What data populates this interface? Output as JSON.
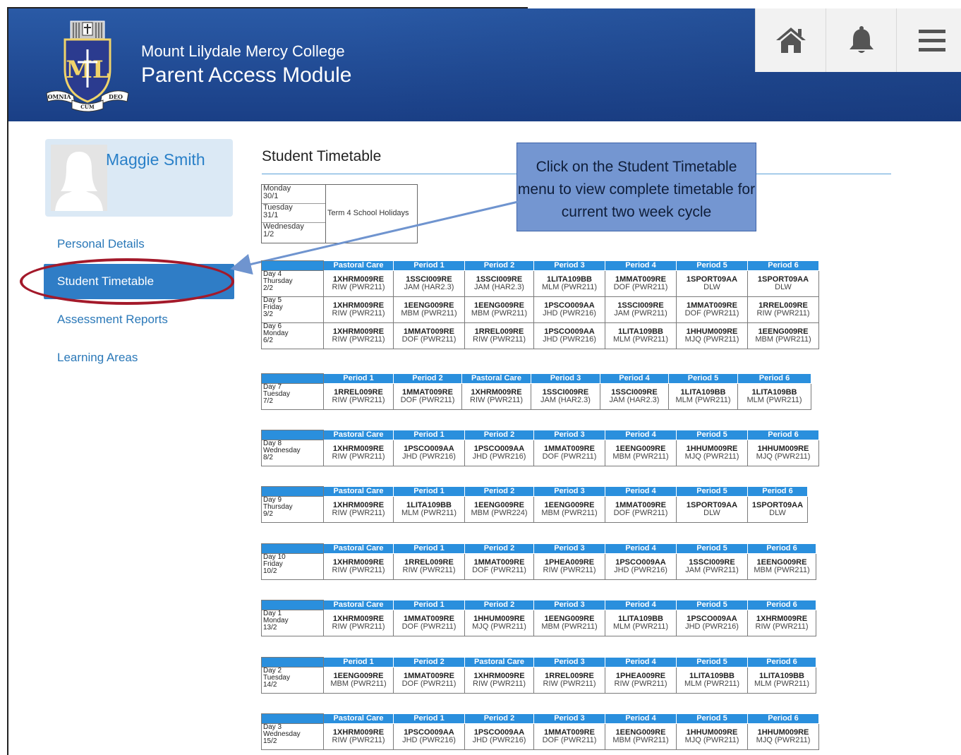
{
  "header": {
    "college_name": "Mount Lilydale Mercy College",
    "module_name": "Parent Access Module",
    "crest_text": [
      "OMNIA",
      "CUM",
      "DEO"
    ],
    "colors": {
      "header": "#1f4b96",
      "accent": "#2f7dc6",
      "table_header": "#2a8fdd"
    },
    "icons": [
      "home-icon",
      "bell-icon",
      "menu-icon"
    ]
  },
  "profile": {
    "name": "Maggie Smith"
  },
  "nav": {
    "personal_details": "Personal Details",
    "student_timetable": "Student Timetable",
    "assessment_reports": "Assessment Reports",
    "learning_areas": "Learning Areas"
  },
  "page": {
    "title": "Student Timetable"
  },
  "callout": {
    "text": "Click on the Student Timetable menu to view complete timetable for current two week cycle"
  },
  "holidays": {
    "days": [
      [
        "Monday",
        "30/1"
      ],
      [
        "Tuesday",
        "31/1"
      ],
      [
        "Wednesday",
        "1/2"
      ]
    ],
    "text": "Term 4 School Holidays"
  },
  "timetables": [
    {
      "headers": [
        "Pastoral Care",
        "Period 1",
        "Period 2",
        "Period 3",
        "Period 4",
        "Period 5",
        "Period 6"
      ],
      "rows": [
        {
          "day": [
            "Day 4",
            "Thursday",
            "2/2"
          ],
          "cells": [
            [
              "1XHRM009RE",
              "RIW (PWR211)"
            ],
            [
              "1SSCI009RE",
              "JAM (HAR2.3)"
            ],
            [
              "1SSCI009RE",
              "JAM (HAR2.3)"
            ],
            [
              "1LITA109BB",
              "MLM (PWR211)"
            ],
            [
              "1MMAT009RE",
              "DOF (PWR211)"
            ],
            [
              "1SPORT09AA",
              "DLW"
            ],
            [
              "1SPORT09AA",
              "DLW"
            ]
          ]
        },
        {
          "day": [
            "Day 5",
            "Friday",
            "3/2"
          ],
          "cells": [
            [
              "1XHRM009RE",
              "RIW (PWR211)"
            ],
            [
              "1EENG009RE",
              "MBM (PWR211)"
            ],
            [
              "1EENG009RE",
              "MBM (PWR211)"
            ],
            [
              "1PSCO009AA",
              "JHD (PWR216)"
            ],
            [
              "1SSCI009RE",
              "JAM (PWR211)"
            ],
            [
              "1MMAT009RE",
              "DOF (PWR211)"
            ],
            [
              "1RREL009RE",
              "RIW (PWR211)"
            ]
          ]
        },
        {
          "day": [
            "Day 6",
            "Monday",
            "6/2"
          ],
          "cells": [
            [
              "1XHRM009RE",
              "RIW (PWR211)"
            ],
            [
              "1MMAT009RE",
              "DOF (PWR211)"
            ],
            [
              "1RREL009RE",
              "RIW (PWR211)"
            ],
            [
              "1PSCO009AA",
              "JHD (PWR216)"
            ],
            [
              "1LITA109BB",
              "MLM (PWR211)"
            ],
            [
              "1HHUM009RE",
              "MJQ (PWR211)"
            ],
            [
              "1EENG009RE",
              "MBM (PWR211)"
            ]
          ]
        }
      ]
    },
    {
      "headers": [
        "Period 1",
        "Period 2",
        "Pastoral Care",
        "Period 3",
        "Period 4",
        "Period 5",
        "Period 6"
      ],
      "rows": [
        {
          "day": [
            "Day 7",
            "Tuesday",
            "7/2"
          ],
          "cells": [
            [
              "1RREL009RE",
              "RIW (PWR211)"
            ],
            [
              "1MMAT009RE",
              "DOF (PWR211)"
            ],
            [
              "1XHRM009RE",
              "RIW (PWR211)"
            ],
            [
              "1SSCI009RE",
              "JAM (HAR2.3)"
            ],
            [
              "1SSCI009RE",
              "JAM (HAR2.3)"
            ],
            [
              "1LITA109BB",
              "MLM (PWR211)"
            ],
            [
              "1LITA109BB",
              "MLM (PWR211)"
            ]
          ]
        }
      ]
    },
    {
      "headers": [
        "Pastoral Care",
        "Period 1",
        "Period 2",
        "Period 3",
        "Period 4",
        "Period 5",
        "Period 6"
      ],
      "rows": [
        {
          "day": [
            "Day 8",
            "Wednesday",
            "8/2"
          ],
          "cells": [
            [
              "1XHRM009RE",
              "RIW (PWR211)"
            ],
            [
              "1PSCO009AA",
              "JHD (PWR216)"
            ],
            [
              "1PSCO009AA",
              "JHD (PWR216)"
            ],
            [
              "1MMAT009RE",
              "DOF (PWR211)"
            ],
            [
              "1EENG009RE",
              "MBM (PWR211)"
            ],
            [
              "1HHUM009RE",
              "MJQ (PWR211)"
            ],
            [
              "1HHUM009RE",
              "MJQ (PWR211)"
            ]
          ]
        }
      ]
    },
    {
      "headers": [
        "Pastoral Care",
        "Period 1",
        "Period 2",
        "Period 3",
        "Period 4",
        "Period 5",
        "Period 6"
      ],
      "rows": [
        {
          "day": [
            "Day 9",
            "Thursday",
            "9/2"
          ],
          "cells": [
            [
              "1XHRM009RE",
              "RIW (PWR211)"
            ],
            [
              "1LITA109BB",
              "MLM (PWR211)"
            ],
            [
              "1EENG009RE",
              "MBM (PWR224)"
            ],
            [
              "1EENG009RE",
              "MBM (PWR211)"
            ],
            [
              "1MMAT009RE",
              "DOF (PWR211)"
            ],
            [
              "1SPORT09AA",
              "DLW"
            ],
            [
              "1SPORT09AA",
              "DLW"
            ]
          ]
        }
      ]
    },
    {
      "headers": [
        "Pastoral Care",
        "Period 1",
        "Period 2",
        "Period 3",
        "Period 4",
        "Period 5",
        "Period 6"
      ],
      "rows": [
        {
          "day": [
            "Day 10",
            "Friday",
            "10/2"
          ],
          "cells": [
            [
              "1XHRM009RE",
              "RIW (PWR211)"
            ],
            [
              "1RREL009RE",
              "RIW (PWR211)"
            ],
            [
              "1MMAT009RE",
              "DOF (PWR211)"
            ],
            [
              "1PHEA009RE",
              "RIW (PWR211)"
            ],
            [
              "1PSCO009AA",
              "JHD (PWR216)"
            ],
            [
              "1SSCI009RE",
              "JAM (PWR211)"
            ],
            [
              "1EENG009RE",
              "MBM (PWR211)"
            ]
          ]
        }
      ]
    },
    {
      "headers": [
        "Pastoral Care",
        "Period 1",
        "Period 2",
        "Period 3",
        "Period 4",
        "Period 5",
        "Period 6"
      ],
      "rows": [
        {
          "day": [
            "Day 1",
            "Monday",
            "13/2"
          ],
          "cells": [
            [
              "1XHRM009RE",
              "RIW (PWR211)"
            ],
            [
              "1MMAT009RE",
              "DOF (PWR211)"
            ],
            [
              "1HHUM009RE",
              "MJQ (PWR211)"
            ],
            [
              "1EENG009RE",
              "MBM (PWR211)"
            ],
            [
              "1LITA109BB",
              "MLM (PWR211)"
            ],
            [
              "1PSCO009AA",
              "JHD (PWR216)"
            ],
            [
              "1XHRM009RE",
              "RIW (PWR211)"
            ]
          ]
        }
      ]
    },
    {
      "headers": [
        "Period 1",
        "Period 2",
        "Pastoral Care",
        "Period 3",
        "Period 4",
        "Period 5",
        "Period 6"
      ],
      "rows": [
        {
          "day": [
            "Day 2",
            "Tuesday",
            "14/2"
          ],
          "cells": [
            [
              "1EENG009RE",
              "MBM (PWR211)"
            ],
            [
              "1MMAT009RE",
              "DOF (PWR211)"
            ],
            [
              "1XHRM009RE",
              "RIW (PWR211)"
            ],
            [
              "1RREL009RE",
              "RIW (PWR211)"
            ],
            [
              "1PHEA009RE",
              "RIW (PWR211)"
            ],
            [
              "1LITA109BB",
              "MLM (PWR211)"
            ],
            [
              "1LITA109BB",
              "MLM (PWR211)"
            ]
          ]
        }
      ]
    },
    {
      "headers": [
        "Pastoral Care",
        "Period 1",
        "Period 2",
        "Period 3",
        "Period 4",
        "Period 5",
        "Period 6"
      ],
      "rows": [
        {
          "day": [
            "Day 3",
            "Wednesday",
            "15/2"
          ],
          "cells": [
            [
              "1XHRM009RE",
              "RIW (PWR211)"
            ],
            [
              "1PSCO009AA",
              "JHD (PWR216)"
            ],
            [
              "1PSCO009AA",
              "JHD (PWR216)"
            ],
            [
              "1MMAT009RE",
              "DOF (PWR211)"
            ],
            [
              "1EENG009RE",
              "MBM (PWR211)"
            ],
            [
              "1HHUM009RE",
              "MJQ (PWR211)"
            ],
            [
              "1HHUM009RE",
              "MJQ (PWR211)"
            ]
          ]
        }
      ]
    }
  ]
}
